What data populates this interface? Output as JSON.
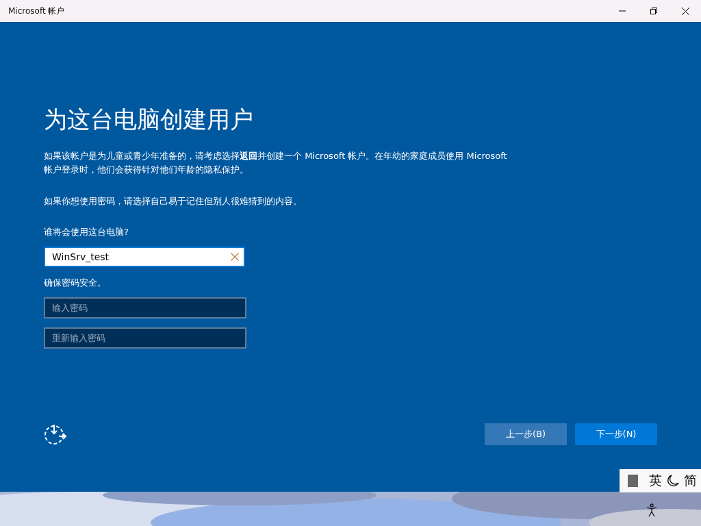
{
  "window": {
    "title": "Microsoft 帐户"
  },
  "heading": "为这台电脑创建用户",
  "paragraphs": [
    "如果该帐户是为儿童或青少年准备的，请考虑选择**返回**并创建一个 Microsoft 帐户。在年幼的家庭成员使用 Microsoft 帐户登录时，他们会获得针对他们年龄的隐私保护。",
    "如果你想使用密码，请选择自己易于记住但别人很难猜到的内容。"
  ],
  "name_label": "谁将会使用这台电脑?",
  "name_field": {
    "value": "WinSrv_test"
  },
  "password_label": "确保密码安全。",
  "password_fields": [
    {
      "placeholder": "输入密码"
    },
    {
      "placeholder": "重新输入密码"
    }
  ],
  "buttons": [
    {
      "label": "上一步(B)",
      "kind": "secondary"
    },
    {
      "label": "下一步(N)",
      "kind": "primary"
    }
  ],
  "ime_bar": {
    "mode": "英",
    "script": "简"
  }
}
